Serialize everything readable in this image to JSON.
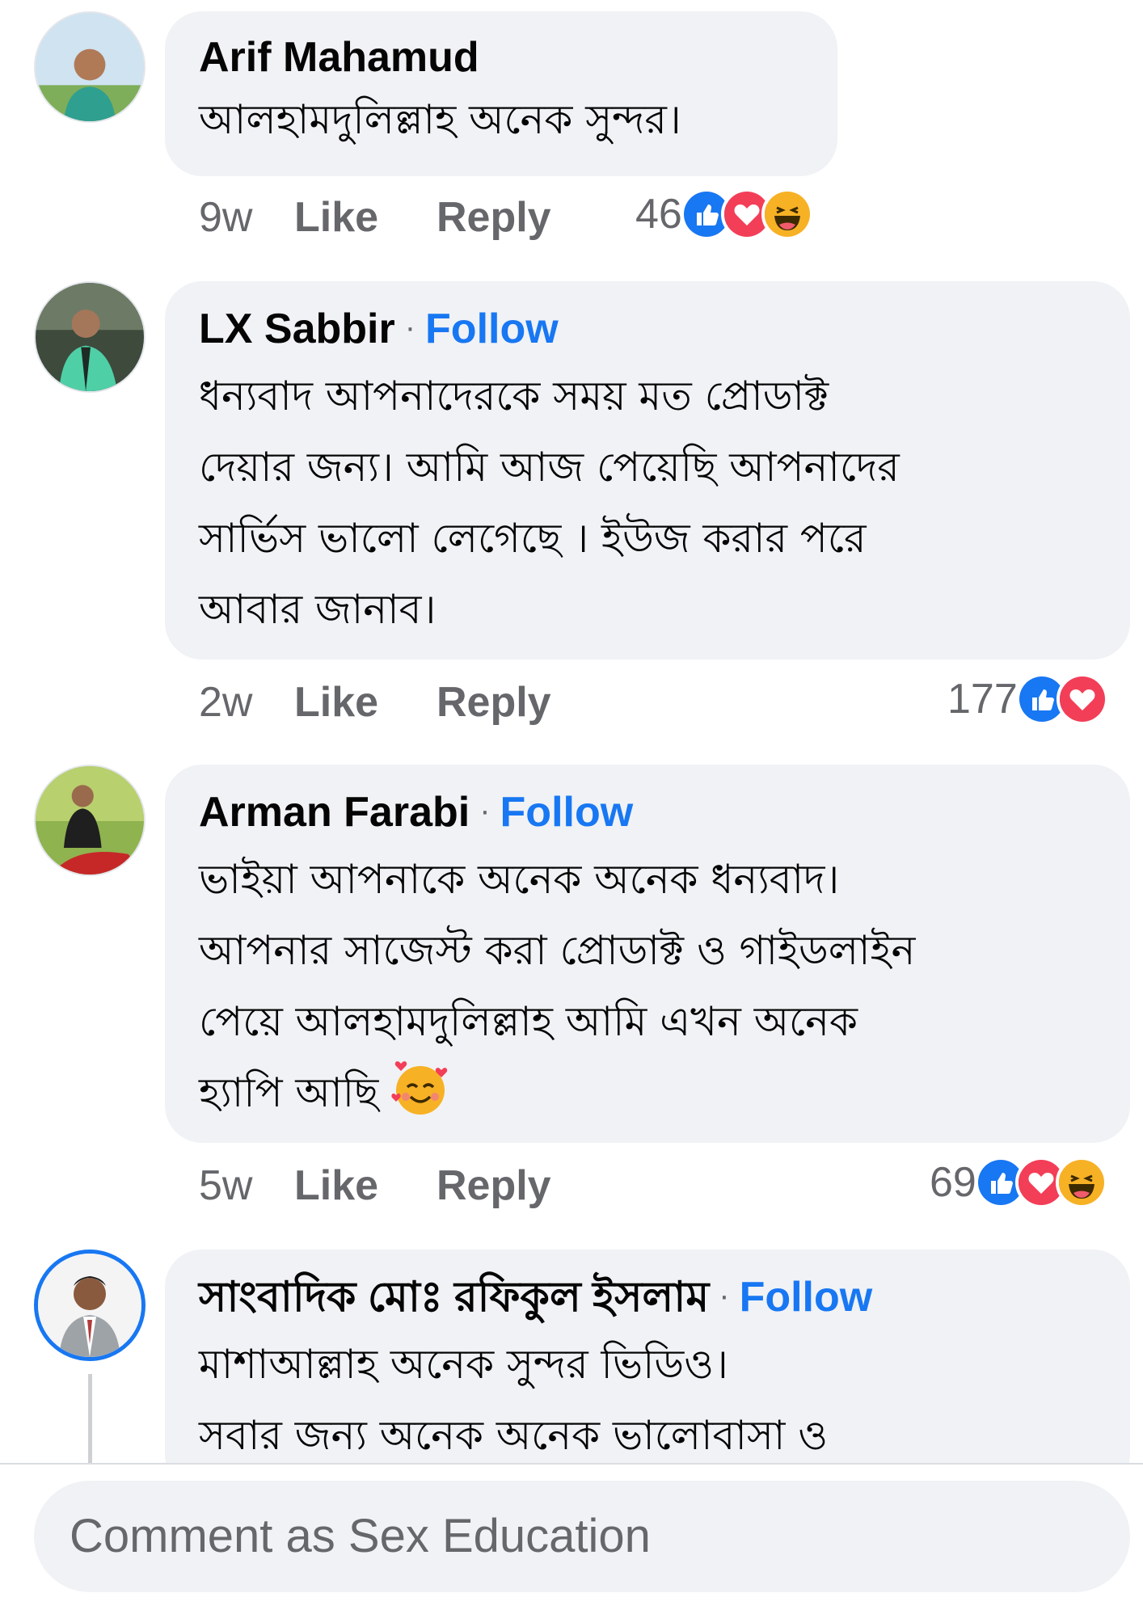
{
  "comments": [
    {
      "author": "Arif Mahamud",
      "follow": "",
      "lines": [
        "আলহামদুলিল্লাহ অনেক সুন্দর।"
      ],
      "time": "9w",
      "like": "Like",
      "reply": "Reply",
      "reaction_count": "46",
      "reactions": [
        "like-icon",
        "love-icon",
        "haha-icon"
      ]
    },
    {
      "author": "LX Sabbir",
      "follow": "Follow",
      "lines": [
        "ধন্যবাদ আপনাদেরকে সময় মত প্রোডাক্ট",
        "দেয়ার জন্য। আমি আজ পেয়েছি আপনাদের",
        "সার্ভিস ভালো লেগেছে । ইউজ করার পরে",
        "আবার জানাব।"
      ],
      "time": "2w",
      "like": "Like",
      "reply": "Reply",
      "reaction_count": "177",
      "reactions": [
        "like-icon",
        "love-icon"
      ]
    },
    {
      "author": "Arman Farabi",
      "follow": "Follow",
      "lines": [
        "ভাইয়া আপনাকে অনেক অনেক ধন্যবাদ।",
        "আপনার সাজেস্ট করা প্রোডাক্ট  ও গাইডলাইন",
        "পেয়ে আলহামদুলিল্লাহ আমি এখন অনেক",
        "হ্যাপি আছি"
      ],
      "emoji": "smiling-face-with-hearts-icon",
      "time": "5w",
      "like": "Like",
      "reply": "Reply",
      "reaction_count": "69",
      "reactions": [
        "like-icon",
        "love-icon",
        "haha-icon"
      ]
    },
    {
      "author": "সাংবাদিক মোঃ রফিকুল ইসলাম",
      "follow": "Follow",
      "lines": [
        "মাশাআল্লাহ অনেক সুন্দর ভিডিও।",
        "সবার জন্য অনেক অনেক ভালোবাসা ও"
      ]
    }
  ],
  "footer": {
    "placeholder": "Comment as Sex Education"
  },
  "colors": {
    "accent": "#1877f2",
    "bubble": "#f0f2f5",
    "meta_text": "#65676b",
    "love": "#f33e58",
    "haha": "#f7b125"
  }
}
